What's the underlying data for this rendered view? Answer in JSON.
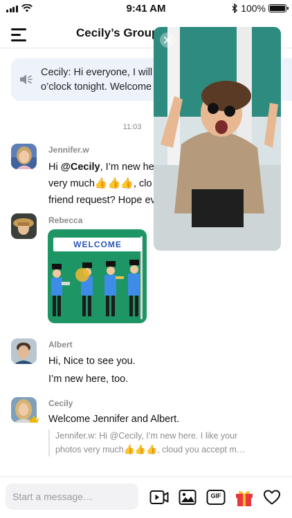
{
  "status_bar": {
    "time": "9:41 AM",
    "battery": "100%"
  },
  "header": {
    "title": "Cecily’s Group"
  },
  "announcement": {
    "line1": "Cecily: Hi everyone, I will s",
    "line2": "o’clock tonight. Welcome"
  },
  "timestamp": "11:03",
  "messages": [
    {
      "sender": "Jennifer.w",
      "line1_prefix": "Hi ",
      "mention": "@Cecily",
      "line1_suffix": ", I’m new here",
      "line2_text": "very much",
      "line2_emoji": "👍👍👍",
      "line2_suffix": ", clo",
      "line3": "friend request? Hope eve"
    },
    {
      "sender": "Rebecca",
      "sticker_text": "WELCOME"
    },
    {
      "sender": "Albert",
      "line1": "Hi, Nice to see you.",
      "line2": "I’m new here,  too."
    },
    {
      "sender": "Cecily",
      "text": "Welcome Jennifer and Albert.",
      "quote_line1": "Jennifer.w: Hi @Cecily, I’m new here. I like your",
      "quote_line2_text": "photos very much",
      "quote_line2_emoji": "👍👍👍",
      "quote_line2_suffix": ", cloud you accept m…"
    }
  ],
  "input": {
    "placeholder": "Start a message…"
  },
  "toolbar": {
    "icons": [
      "video-icon",
      "image-icon",
      "gif-icon",
      "gift-icon",
      "heart-icon"
    ],
    "gif_label": "GIF"
  },
  "colors": {
    "accent_bg": "#eef3fb",
    "sticker_green": "#1e9565",
    "gift_red": "#e8383d",
    "gift_gold": "#f5c028",
    "crown_gold": "#f2b705"
  }
}
